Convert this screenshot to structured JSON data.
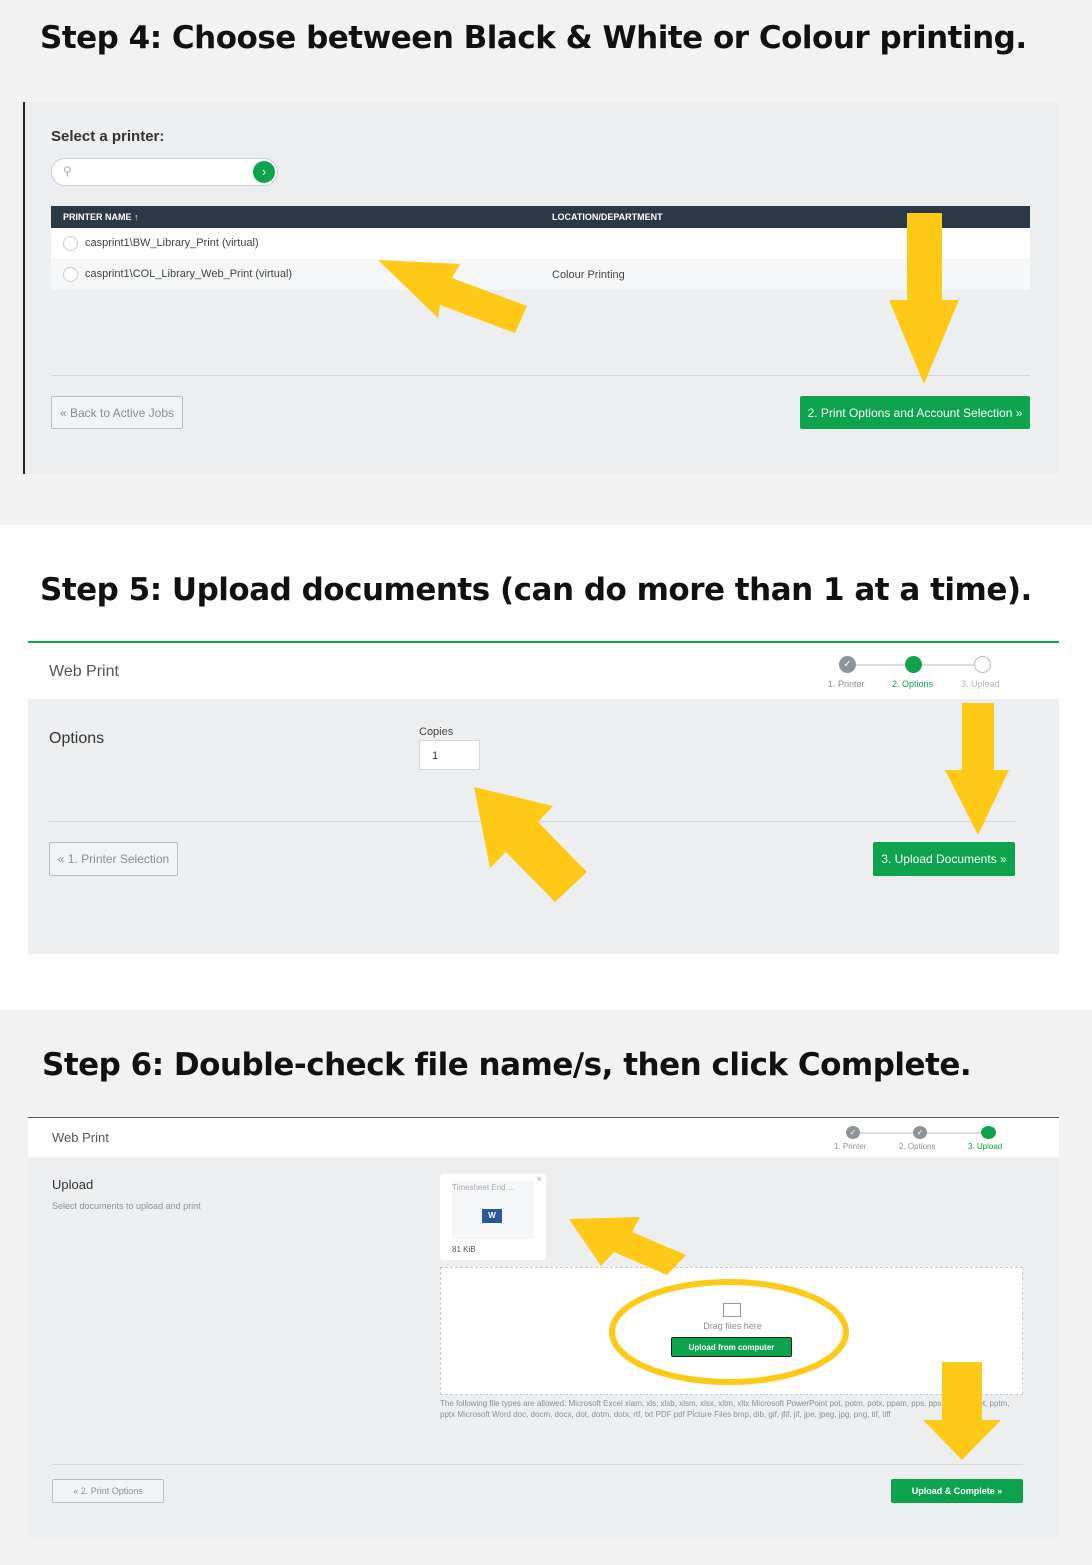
{
  "colors": {
    "accent": "#0ea34d",
    "arrow": "#FFC917",
    "header_dark": "#2b3846"
  },
  "step4": {
    "title": "Step 4: Choose between Black & White or Colour printing.",
    "select_label": "Select a printer:",
    "search_placeholder": "",
    "table": {
      "headers": [
        "PRINTER NAME ↑",
        "LOCATION/DEPARTMENT"
      ],
      "rows": [
        {
          "name": "casprint1\\BW_Library_Print (virtual)",
          "location": ""
        },
        {
          "name": "casprint1\\COL_Library_Web_Print (virtual)",
          "location": "Colour Printing"
        }
      ]
    },
    "back_label": "« Back to Active Jobs",
    "next_label": "2. Print Options and Account Selection »"
  },
  "step5": {
    "title": "Step 5: Upload documents (can do more than 1 at a time).",
    "app_title": "Web Print",
    "steps": [
      "1. Printer",
      "2. Options",
      "3. Upload"
    ],
    "section_label": "Options",
    "copies_label": "Copies",
    "copies_value": "1",
    "back_label": "« 1. Printer Selection",
    "next_label": "3. Upload Documents »"
  },
  "step6": {
    "title": "Step 6:  Double-check file name/s, then click Complete.",
    "app_title": "Web Print",
    "steps": [
      "1. Printer",
      "2. Options",
      "3. Upload"
    ],
    "section_label": "Upload",
    "section_desc": "Select documents to upload and print",
    "file": {
      "name": "Timesheet End ...",
      "size": "81 KiB",
      "close": "×"
    },
    "drop_text": "Drag files here",
    "upload_button": "Upload from computer",
    "allowed_types": "The following file types are allowed: Microsoft Excel xlam, xls, xlsb, xlsm, xlsx, xltm, xltx Microsoft PowerPoint pot, potm, potx, ppam, pps, ppsm, ppsx, ppt, pptm, pptx Microsoft Word doc, docm, docx, dot, dotm, dotx, rtf, txt PDF pdf Picture Files bmp, dib, gif, jfif, jif, jpe, jpeg, jpg, png, tif, tiff",
    "back_label": "« 2. Print Options",
    "next_label": "Upload & Complete »"
  }
}
